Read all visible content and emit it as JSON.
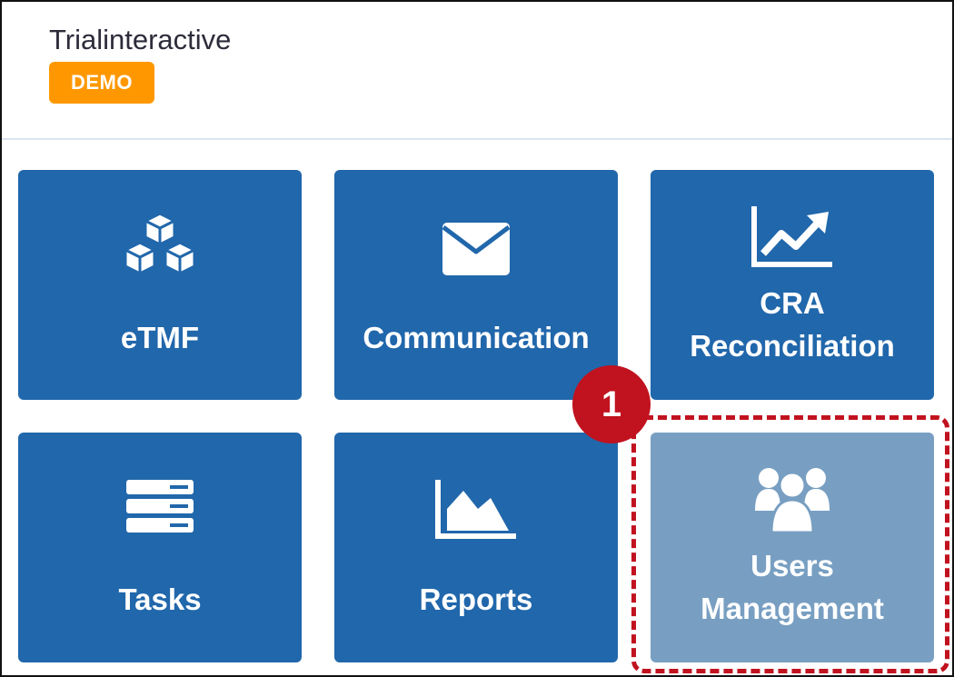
{
  "app": {
    "title": "Trialinteractive",
    "badge": "DEMO"
  },
  "tiles": [
    {
      "label_lines": [
        "eTMF"
      ],
      "icon": "cubes-icon"
    },
    {
      "label_lines": [
        "Communication"
      ],
      "icon": "envelope-icon"
    },
    {
      "label_lines": [
        "CRA",
        "Reconciliation"
      ],
      "icon": "line-chart-icon"
    },
    {
      "label_lines": [
        "Tasks"
      ],
      "icon": "server-icon"
    },
    {
      "label_lines": [
        "Reports"
      ],
      "icon": "area-chart-icon"
    },
    {
      "label_lines": [
        "Users",
        "Management"
      ],
      "icon": "users-icon",
      "highlighted": true
    }
  ],
  "annotation": {
    "step_number": "1"
  },
  "colors": {
    "tile_background": "#2167ab",
    "tile_background_highlighted": "#789fc2",
    "demo_badge": "#ff9800",
    "annotation_red": "#c1121f"
  }
}
